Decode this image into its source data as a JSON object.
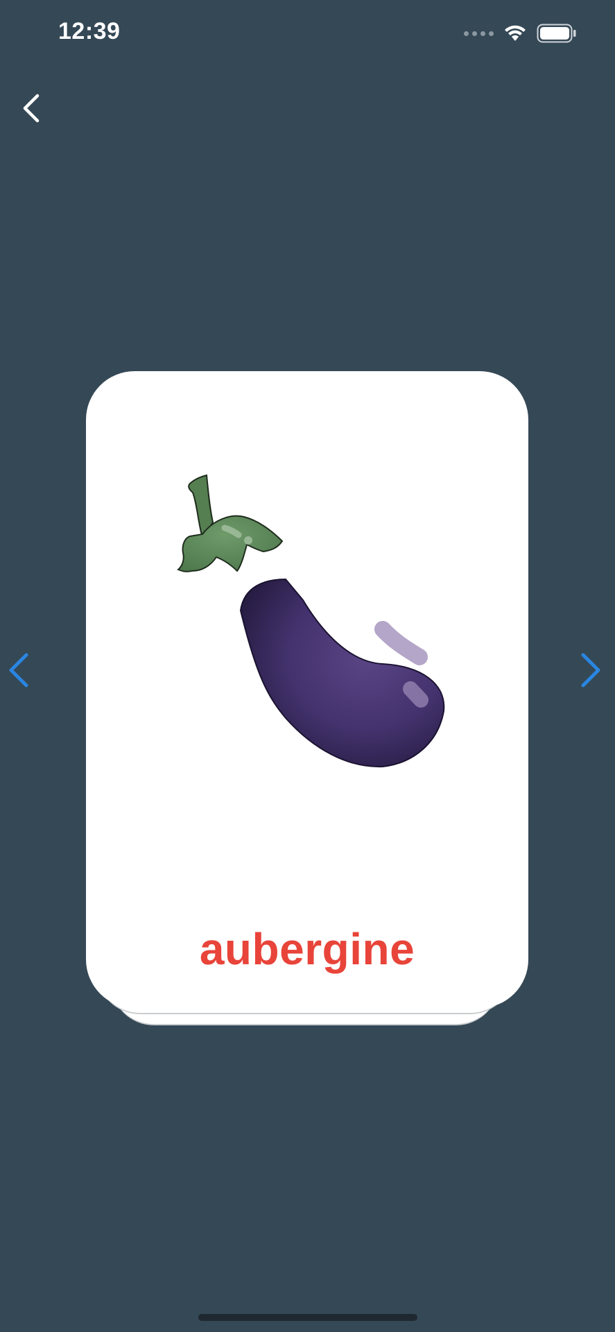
{
  "status_bar": {
    "time": "12:39"
  },
  "card": {
    "word": "aubergine",
    "image_icon": "eggplant-illustration",
    "word_color": "#e8443a"
  },
  "navigation": {
    "back_icon": "chevron-left-icon",
    "prev_icon": "chevron-left-icon",
    "next_icon": "chevron-right-icon",
    "arrow_color": "#2a86e0"
  },
  "colors": {
    "background": "#354856",
    "card": "#ffffff"
  }
}
